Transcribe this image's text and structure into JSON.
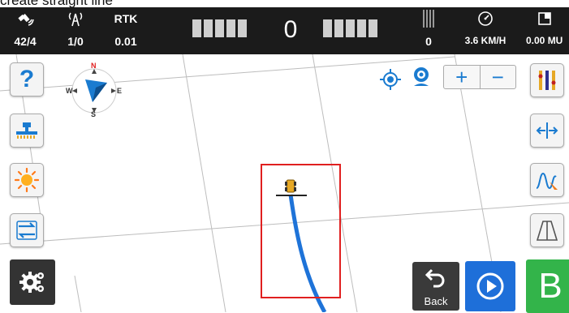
{
  "caption": "create straight line",
  "status_bar": {
    "satellites": "42/4",
    "base": "1/0",
    "rtk_label": "RTK",
    "rtk_value": "0.01",
    "counter": "0",
    "bars_value": "0",
    "speed": "3.6 KM/H",
    "area": "0.00 MU"
  },
  "compass": {
    "n": "N",
    "s": "S",
    "e": "E",
    "w": "W"
  },
  "buttons": {
    "back_label": "Back",
    "b_label": "B",
    "help": "?"
  },
  "zoom": {
    "plus": "+",
    "minus": "−"
  },
  "colors": {
    "top_bar": "#1b1b1b",
    "path": "#1e73d8",
    "highlight": "#e02020",
    "b_button": "#33b44a",
    "play_button": "#1e6fd9"
  }
}
